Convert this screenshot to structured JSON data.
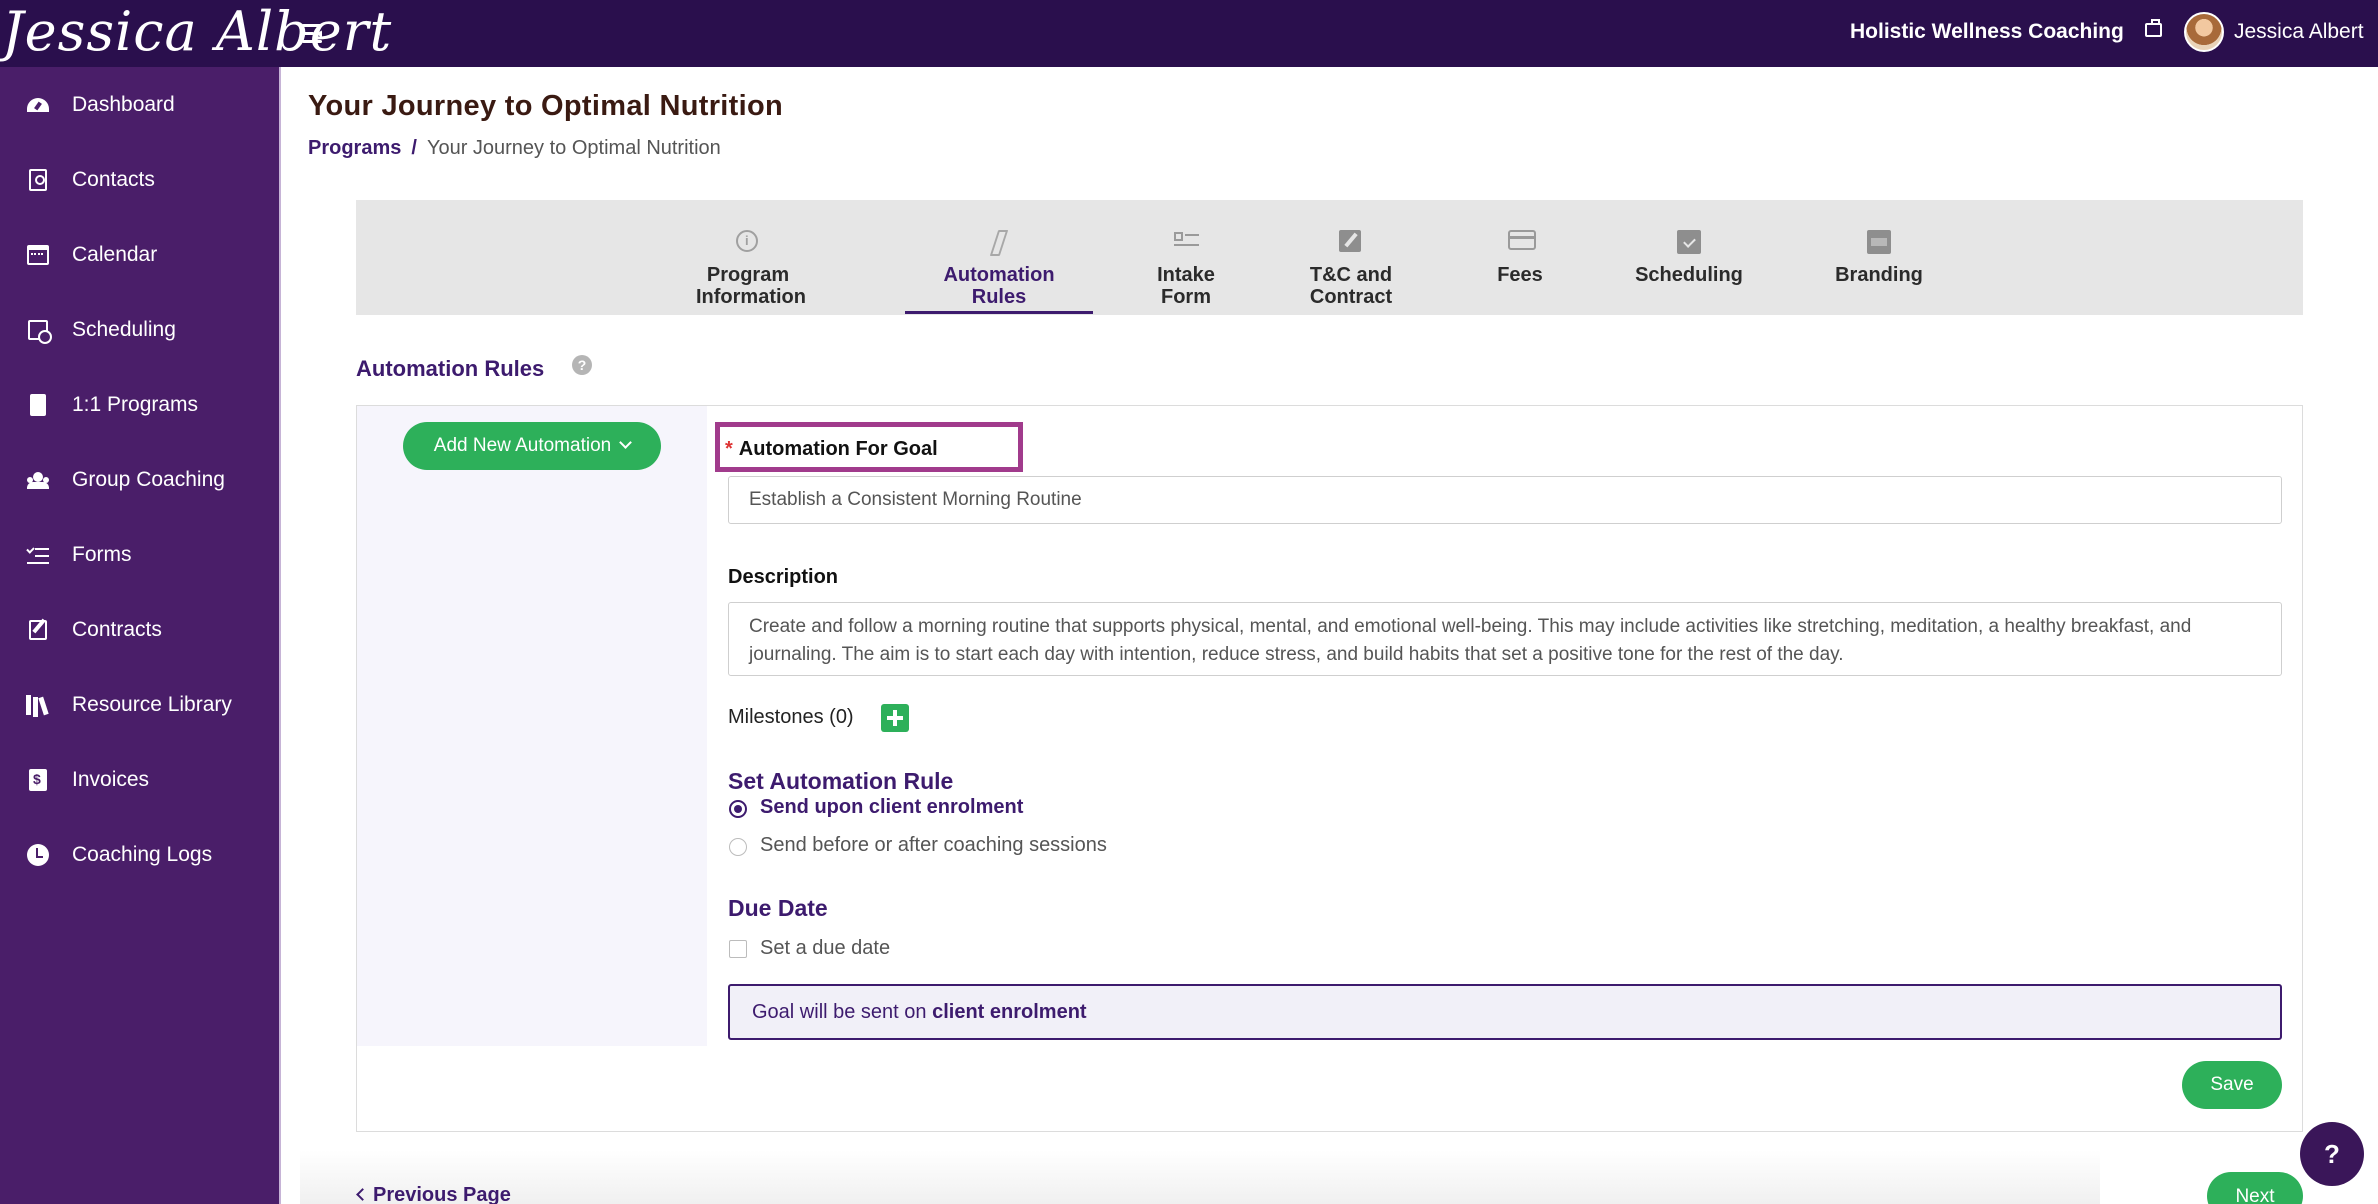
{
  "topbar": {
    "logo_text": "Jessica Albert",
    "org_name": "Holistic Wellness Coaching",
    "user_name": "Jessica Albert"
  },
  "sidebar": {
    "items": [
      {
        "label": "Dashboard",
        "icon": "dashboard-icon"
      },
      {
        "label": "Contacts",
        "icon": "contacts-icon"
      },
      {
        "label": "Calendar",
        "icon": "calendar-icon"
      },
      {
        "label": "Scheduling",
        "icon": "scheduling-icon"
      },
      {
        "label": "1:1 Programs",
        "icon": "programs-icon"
      },
      {
        "label": "Group Coaching",
        "icon": "group-icon"
      },
      {
        "label": "Forms",
        "icon": "forms-icon"
      },
      {
        "label": "Contracts",
        "icon": "contracts-icon"
      },
      {
        "label": "Resource Library",
        "icon": "library-icon"
      },
      {
        "label": "Invoices",
        "icon": "invoice-icon"
      },
      {
        "label": "Coaching Logs",
        "icon": "clock-icon"
      }
    ]
  },
  "header": {
    "title": "Your Journey to Optimal Nutrition",
    "breadcrumb": {
      "link": "Programs",
      "separator": "/",
      "current": "Your Journey to Optimal Nutrition"
    }
  },
  "steps": [
    {
      "line1": "Program",
      "line2": "Information",
      "icon": "info-icon",
      "active": false
    },
    {
      "line1": "Automation",
      "line2": "Rules",
      "icon": "bolt-icon",
      "active": true
    },
    {
      "line1": "Intake",
      "line2": "Form",
      "icon": "checklist-icon",
      "active": false
    },
    {
      "line1": "T&C and",
      "line2": "Contract",
      "icon": "signature-icon",
      "active": false
    },
    {
      "line1": "Fees",
      "line2": "",
      "icon": "credit-card-icon",
      "active": false
    },
    {
      "line1": "Scheduling",
      "line2": "",
      "icon": "calendar-check-icon",
      "active": false
    },
    {
      "line1": "Branding",
      "line2": "",
      "icon": "branding-icon",
      "active": false
    }
  ],
  "section": {
    "title": "Automation Rules",
    "help": "?"
  },
  "automation": {
    "add_button": "Add New Automation",
    "goal_label": "Automation For Goal",
    "required_mark": "*",
    "goal_value": "Establish a Consistent Morning Routine",
    "description_label": "Description",
    "description_value": "Create and follow a morning routine that supports physical, mental, and emotional well-being. This may include activities like stretching, meditation, a healthy breakfast, and journaling. The aim is to start each day with intention, reduce stress, and build habits that set a positive tone for the rest of the day.",
    "milestones_label": "Milestones (0)",
    "rule_title": "Set Automation Rule",
    "rule_options": [
      {
        "label": "Send upon client enrolment",
        "selected": true
      },
      {
        "label": "Send before or after coaching sessions",
        "selected": false
      }
    ],
    "due_title": "Due Date",
    "due_checkbox_label": "Set a due date",
    "due_checked": false,
    "info_prefix": "Goal will be sent on ",
    "info_bold": "client enrolment",
    "save_label": "Save"
  },
  "footer": {
    "prev_label": "Previous Page",
    "next_label": "Next",
    "help_label": "?"
  },
  "colors": {
    "topbar": "#2a0f4d",
    "sidebar": "#4a1e69",
    "accent": "#3d1b6e",
    "success": "#2db05a",
    "highlight_border": "#a13b8c"
  }
}
